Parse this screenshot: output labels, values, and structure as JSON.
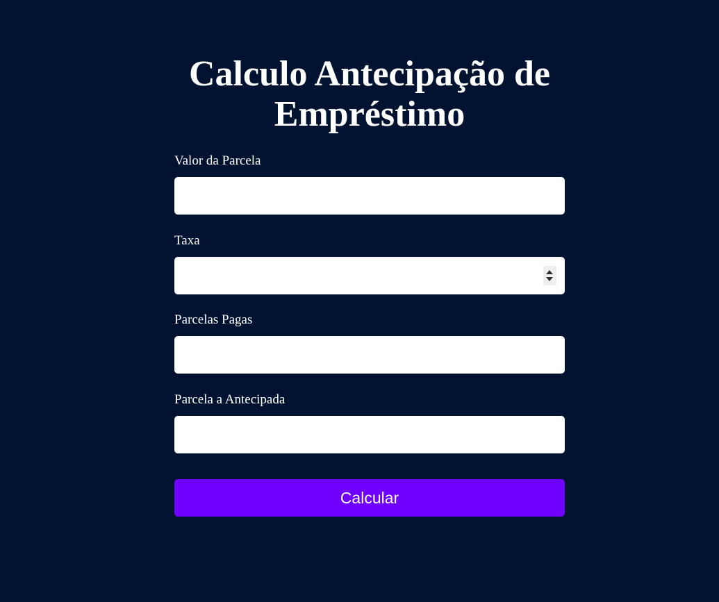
{
  "page": {
    "title": "Calculo Antecipação de Empréstimo"
  },
  "form": {
    "fields": [
      {
        "label": "Valor da Parcela",
        "value": ""
      },
      {
        "label": "Taxa",
        "value": ""
      },
      {
        "label": "Parcelas Pagas",
        "value": ""
      },
      {
        "label": "Parcela a Antecipada",
        "value": ""
      }
    ],
    "submit_label": "Calcular"
  },
  "colors": {
    "background": "#011330",
    "accent": "#7000ff",
    "text": "#ffffff",
    "input_background": "#ffffff"
  }
}
